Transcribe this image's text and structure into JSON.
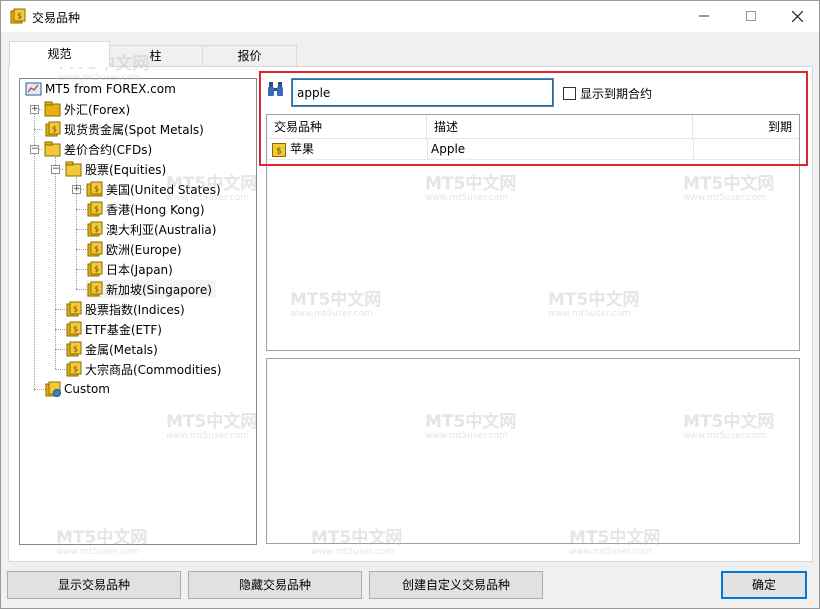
{
  "window": {
    "title": "交易品种",
    "icon": "money-bag-icon",
    "controls": [
      "minimize-icon",
      "maximize-icon",
      "close-icon"
    ]
  },
  "tabs": [
    {
      "label": "规范",
      "active": true
    },
    {
      "label": "柱",
      "active": false
    },
    {
      "label": "报价",
      "active": false
    }
  ],
  "tree": {
    "root": "MT5 from FOREX.com",
    "items": [
      {
        "label": "外汇(Forex)",
        "level": 1,
        "expandable": true,
        "expanded": false
      },
      {
        "label": "现货贵金属(Spot Metals)",
        "level": 1,
        "expandable": false
      },
      {
        "label": "差价合约(CFDs)",
        "level": 1,
        "expandable": true,
        "expanded": true
      },
      {
        "label": "股票(Equities)",
        "level": 2,
        "expandable": true,
        "expanded": true
      },
      {
        "label": "美国(United States)",
        "level": 3,
        "expandable": true,
        "expanded": false
      },
      {
        "label": "香港(Hong Kong)",
        "level": 3,
        "expandable": false
      },
      {
        "label": "澳大利亚(Australia)",
        "level": 3,
        "expandable": false
      },
      {
        "label": "欧洲(Europe)",
        "level": 3,
        "expandable": false
      },
      {
        "label": "日本(Japan)",
        "level": 3,
        "expandable": false
      },
      {
        "label": "新加坡(Singapore)",
        "level": 3,
        "expandable": false,
        "selected": true
      },
      {
        "label": "股票指数(Indices)",
        "level": 2,
        "expandable": false
      },
      {
        "label": "ETF基金(ETF)",
        "level": 2,
        "expandable": false
      },
      {
        "label": "金属(Metals)",
        "level": 2,
        "expandable": false
      },
      {
        "label": "大宗商品(Commodities)",
        "level": 2,
        "expandable": false
      },
      {
        "label": "Custom",
        "level": 1,
        "expandable": false
      }
    ]
  },
  "search": {
    "value": "apple",
    "show_expired_label": "显示到期合约",
    "show_expired_checked": false
  },
  "table": {
    "columns": [
      "交易品种",
      "描述",
      "到期"
    ],
    "rows": [
      {
        "symbol": "苹果",
        "description": "Apple",
        "expiry": ""
      }
    ]
  },
  "watermark": {
    "text": "MT5中文网",
    "sub": "www.mt5user.com"
  },
  "buttons": {
    "show": "显示交易品种",
    "hide": "隐藏交易品种",
    "create": "创建自定义交易品种",
    "ok": "确定"
  },
  "colors": {
    "highlight_box": "#e0262b",
    "folder": "#e8b20c",
    "focus": "#0078d7"
  }
}
